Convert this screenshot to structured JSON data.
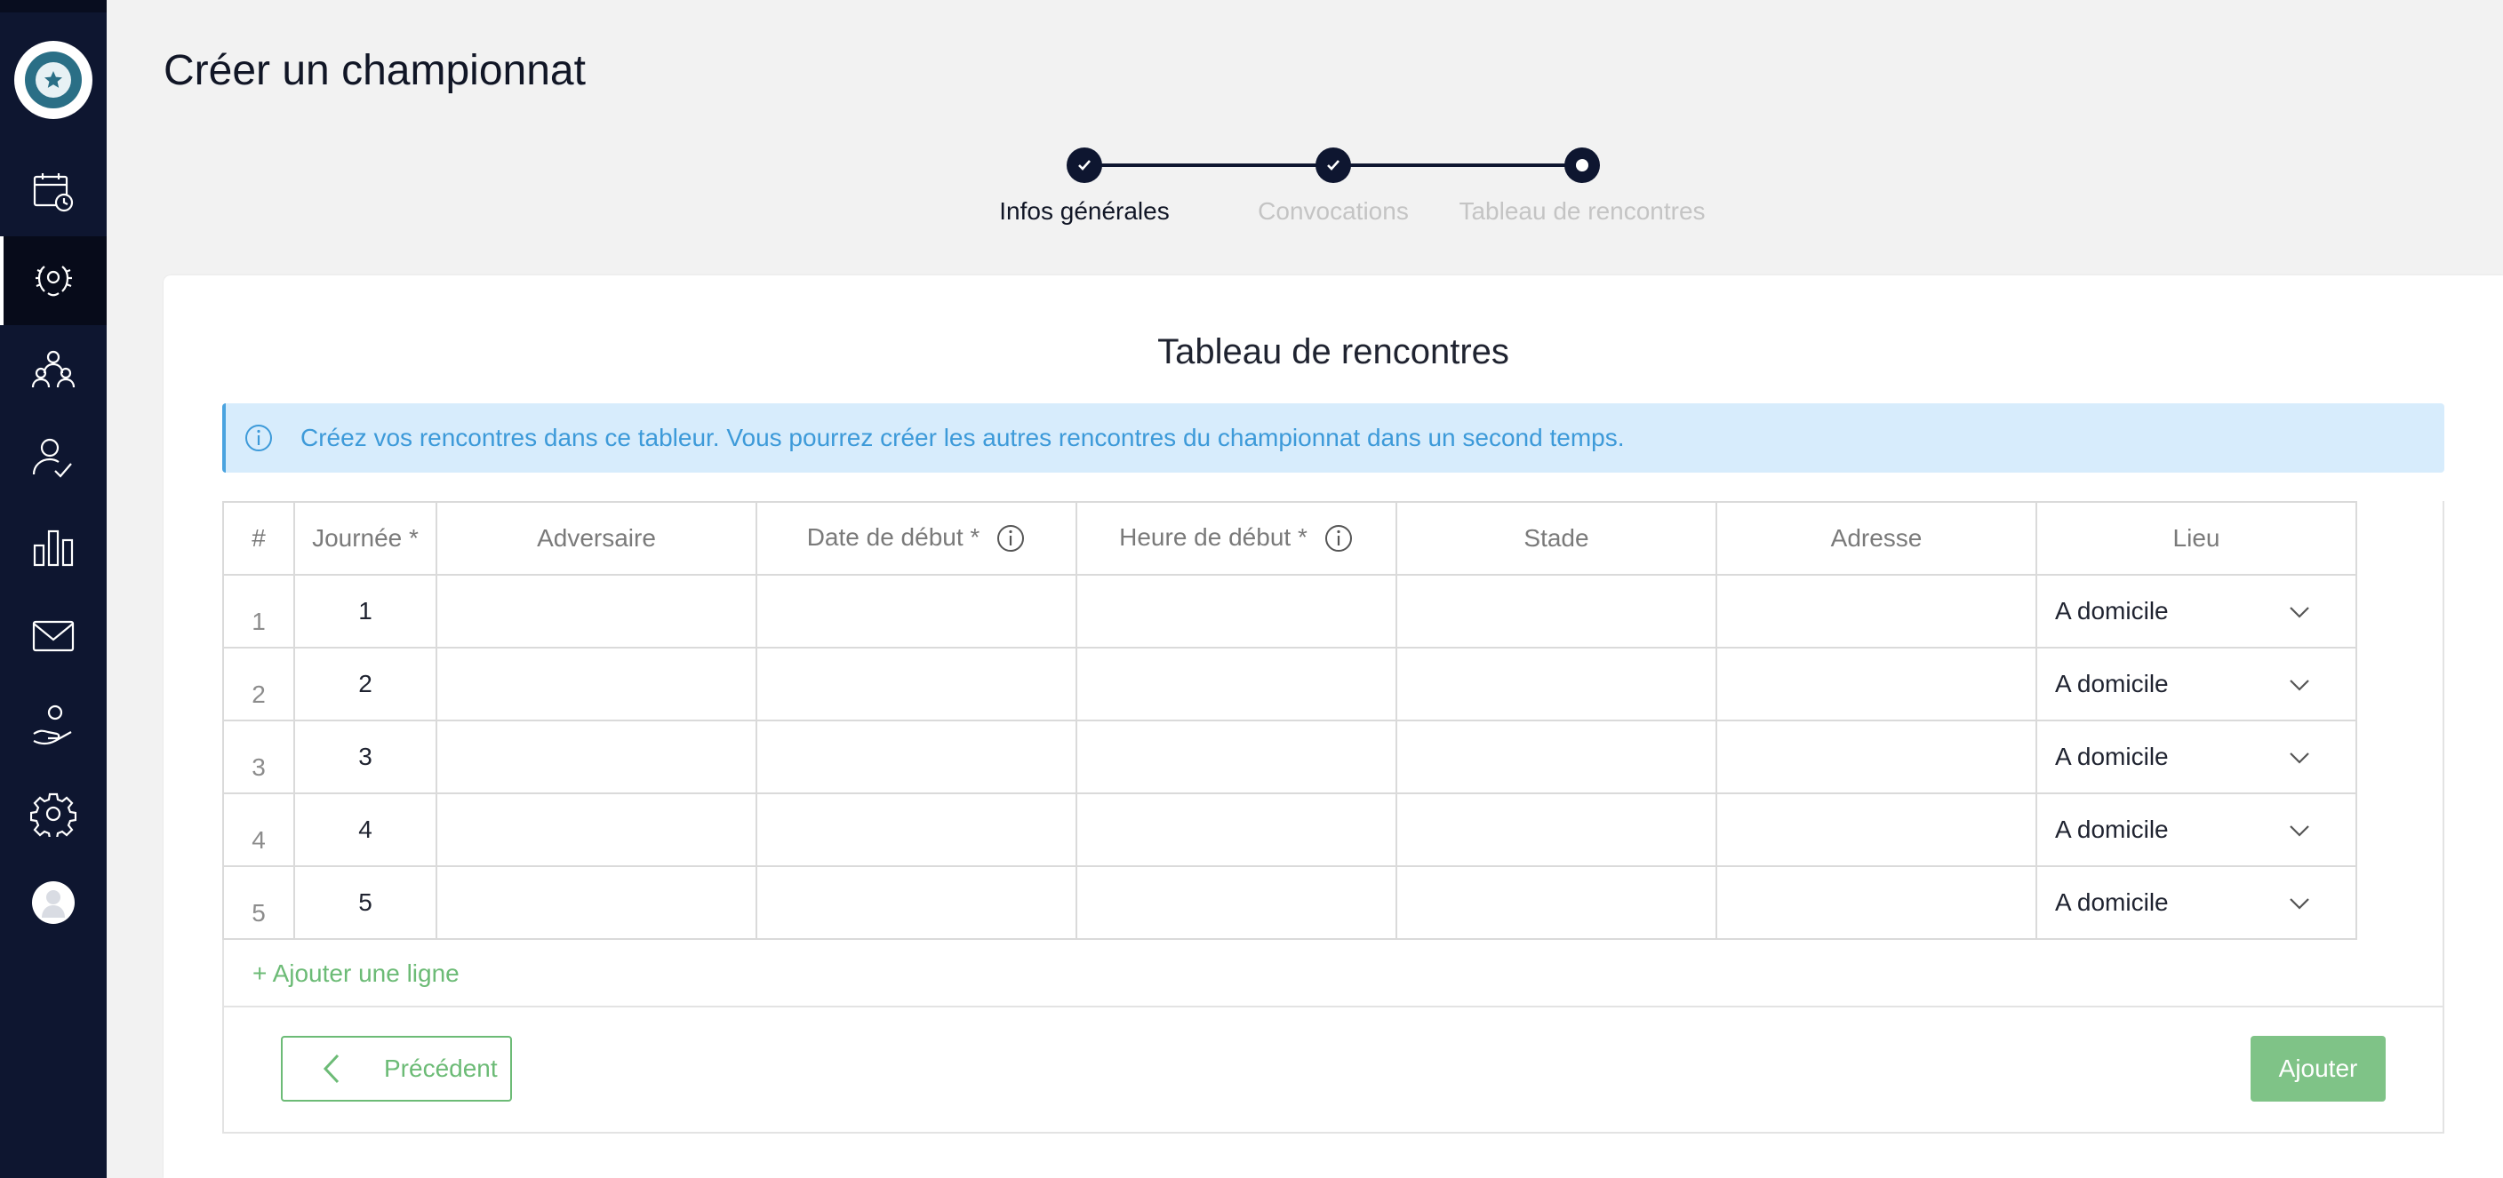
{
  "page": {
    "title": "Créer un championnat"
  },
  "sidebar": {
    "items": [
      {
        "icon": "calendar-clock-icon"
      },
      {
        "icon": "laurel-trophy-icon",
        "active": true
      },
      {
        "icon": "group-icon"
      },
      {
        "icon": "user-check-icon"
      },
      {
        "icon": "bar-chart-icon"
      },
      {
        "icon": "mail-icon"
      },
      {
        "icon": "hand-person-icon"
      },
      {
        "icon": "gear-icon"
      }
    ]
  },
  "stepper": {
    "steps": [
      {
        "label": "Infos générales",
        "state": "done"
      },
      {
        "label": "Convocations",
        "state": "done"
      },
      {
        "label": "Tableau de rencontres",
        "state": "current"
      }
    ]
  },
  "card": {
    "title": "Tableau de rencontres",
    "info": "Créez vos rencontres dans ce tableur. Vous pourrez créer les autres rencontres du championnat dans un second temps."
  },
  "table": {
    "headers": [
      "#",
      "Journée *",
      "Adversaire",
      "Date de début *",
      "Heure de début *",
      "Stade",
      "Adresse",
      "Lieu"
    ],
    "rows": [
      {
        "num": "1",
        "day": "1",
        "adversaire": "",
        "date": "",
        "heure": "",
        "stade": "",
        "adresse": "",
        "lieu": "A domicile"
      },
      {
        "num": "2",
        "day": "2",
        "adversaire": "",
        "date": "",
        "heure": "",
        "stade": "",
        "adresse": "",
        "lieu": "A domicile"
      },
      {
        "num": "3",
        "day": "3",
        "adversaire": "",
        "date": "",
        "heure": "",
        "stade": "",
        "adresse": "",
        "lieu": "A domicile"
      },
      {
        "num": "4",
        "day": "4",
        "adversaire": "",
        "date": "",
        "heure": "",
        "stade": "",
        "adresse": "",
        "lieu": "A domicile"
      },
      {
        "num": "5",
        "day": "5",
        "adversaire": "",
        "date": "",
        "heure": "",
        "stade": "",
        "adresse": "",
        "lieu": "A domicile"
      }
    ]
  },
  "actions": {
    "add_line": "+ Ajouter une ligne",
    "previous": "Précédent",
    "submit": "Ajouter"
  },
  "colors": {
    "sidebar": "#0e1630",
    "accent_green": "#6cbb76",
    "info_blue": "#3d9ad9"
  }
}
